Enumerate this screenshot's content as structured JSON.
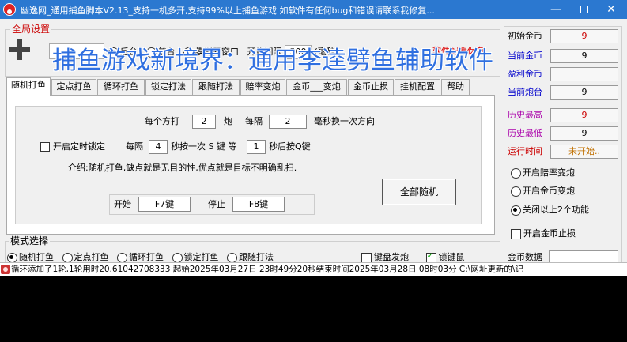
{
  "window": {
    "title": "幽逸网_通用捕鱼脚本V2.13_支持一机多开,支持99%以上捕鱼游戏 如软件有任何bug和错误请联系我修复...",
    "min_label": "—",
    "close_label": "✕"
  },
  "global_settings": {
    "legend": "全局设置",
    "radios": [
      {
        "label": "后台",
        "selected": true
      },
      {
        "label": "前台",
        "selected": false
      },
      {
        "label": "模拟器窗口",
        "selected": false
      }
    ],
    "interval_label": "开炮间隔",
    "interval_value": "500",
    "interval_unit": "(毫秒)",
    "config_save_label": "软件配置保存"
  },
  "watermark": "捕鱼游戏新境界：通用李逵劈鱼辅助软件",
  "tabs": [
    {
      "label": "随机打鱼",
      "active": true
    },
    {
      "label": "定点打鱼",
      "active": false
    },
    {
      "label": "循环打鱼",
      "active": false
    },
    {
      "label": "锁定打法",
      "active": false
    },
    {
      "label": "跟随打法",
      "active": false
    },
    {
      "label": "赔率变炮",
      "active": false
    },
    {
      "label": "金币___变炮",
      "active": false
    },
    {
      "label": "金币止损",
      "active": false
    },
    {
      "label": "挂机配置",
      "active": false
    },
    {
      "label": "帮助",
      "active": false
    }
  ],
  "random_tab": {
    "each_direction_label": "每个方打",
    "shots_per_direction": "2",
    "shots_unit": "炮",
    "every_label": "每隔",
    "change_interval": "2",
    "change_interval_unit": "毫秒换一次方向",
    "timer_lock_label": "开启定时锁定",
    "timer_lock_checked": false,
    "every_label_2": "每隔",
    "lock_interval": "4",
    "lock_press_text": "秒按一次 S 键 等",
    "lock_wait": "1",
    "lock_release_text": "秒后按Q键",
    "intro": "介绍:随机打鱼,缺点就是无目的性,优点就是目标不明确乱扫.",
    "start_label": "开始",
    "start_hotkey": "F7键",
    "stop_label": "停止",
    "stop_hotkey": "F8键",
    "all_random_button": "全部随机"
  },
  "mode_select": {
    "legend": "模式选择",
    "modes": [
      {
        "label": "随机打鱼",
        "selected": true
      },
      {
        "label": "定点打鱼",
        "selected": false
      },
      {
        "label": "循环打鱼",
        "selected": false
      },
      {
        "label": "锁定打鱼",
        "selected": false
      },
      {
        "label": "跟随打法",
        "selected": false
      }
    ],
    "keyboard_fire_label": "键盘发炮",
    "keyboard_fire_checked": false,
    "lock_key_label": "锁键鼠",
    "lock_key_checked": true
  },
  "stats": [
    {
      "label": "初始金币",
      "value": "9",
      "label_color": "#000000",
      "value_color": "#cc0000"
    },
    {
      "label": "当前金币",
      "value": "9",
      "label_color": "#0000cc",
      "value_color": "#000000"
    },
    {
      "label": "盈利金币",
      "value": "",
      "label_color": "#0000cc",
      "value_color": "#000000"
    },
    {
      "label": "当前炮台",
      "value": "9",
      "label_color": "#0000cc",
      "value_color": "#000000"
    },
    {
      "label": "历史最高",
      "value": "9",
      "label_color": "#aa00aa",
      "value_color": "#cc0000"
    },
    {
      "label": "历史最低",
      "value": "9",
      "label_color": "#aa00aa",
      "value_color": "#000000"
    },
    {
      "label": "运行时间",
      "value": "未开始..",
      "label_color": "#cc0000",
      "value_color": "#c07000"
    }
  ],
  "right_options": {
    "radios": [
      {
        "label": "开启赔率变炮",
        "selected": false
      },
      {
        "label": "开启金币变炮",
        "selected": false
      },
      {
        "label": "关闭以上2个功能",
        "selected": true
      }
    ],
    "coin_stop_label": "开启金币止损",
    "coin_stop_checked": false,
    "coin_data_label": "金币数据"
  },
  "status_log": "循环添加了1轮,1轮用时20.61042708333  起始2025年03月27日 23时49分20秒结束时间2025年03月28日 08时03分 C:\\网址更新的\\记"
}
